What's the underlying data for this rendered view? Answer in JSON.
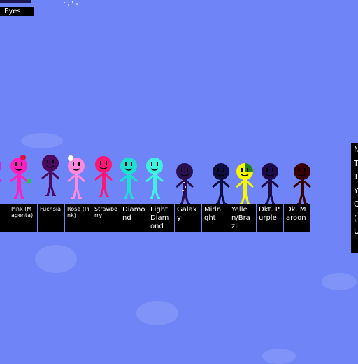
{
  "top_tab": {
    "label": "Eyes"
  },
  "colors": {
    "sky": "#6f84f6",
    "cloud": "#7f93f8",
    "label_bg": "#000000"
  },
  "characters": [
    {
      "name": "",
      "color": "#e020e0",
      "label_size": "small"
    },
    {
      "name": "Pink (Magenta)",
      "color": "#ff1fbf",
      "label_size": "small",
      "accessory": "bow-and-cup"
    },
    {
      "name": "Fuchsia",
      "color": "#4a0a60",
      "label_size": "small"
    },
    {
      "name": "Rose (Pink)",
      "color": "#ff88e0",
      "label_size": "small",
      "accessory": "white-bow"
    },
    {
      "name": "Strawberry",
      "color": "#ff1575",
      "label_size": "small"
    },
    {
      "name": "Diamond",
      "color": "#1de0d0",
      "label_size": "normal"
    },
    {
      "name": "Light Diamond",
      "color": "#40f0e0",
      "label_size": "normal"
    },
    {
      "name": "Galaxy",
      "color": "#2a1050",
      "label_size": "normal",
      "accessory": "stars"
    },
    {
      "name": "Midnight",
      "color": "#0d0d40",
      "label_size": "normal"
    },
    {
      "name": "Yellen/Brazil",
      "color": "#f6f600",
      "label_size": "normal",
      "accessory": "green-half"
    },
    {
      "name": "Dkt. Purple",
      "color": "#1e0a48",
      "label_size": "normal"
    },
    {
      "name": "Dk. Maroon",
      "color": "#3a0000",
      "label_size": "normal"
    }
  ],
  "side_panel": {
    "letters": [
      "N",
      "T",
      "T",
      "Y",
      "C",
      "(",
      "U"
    ]
  }
}
